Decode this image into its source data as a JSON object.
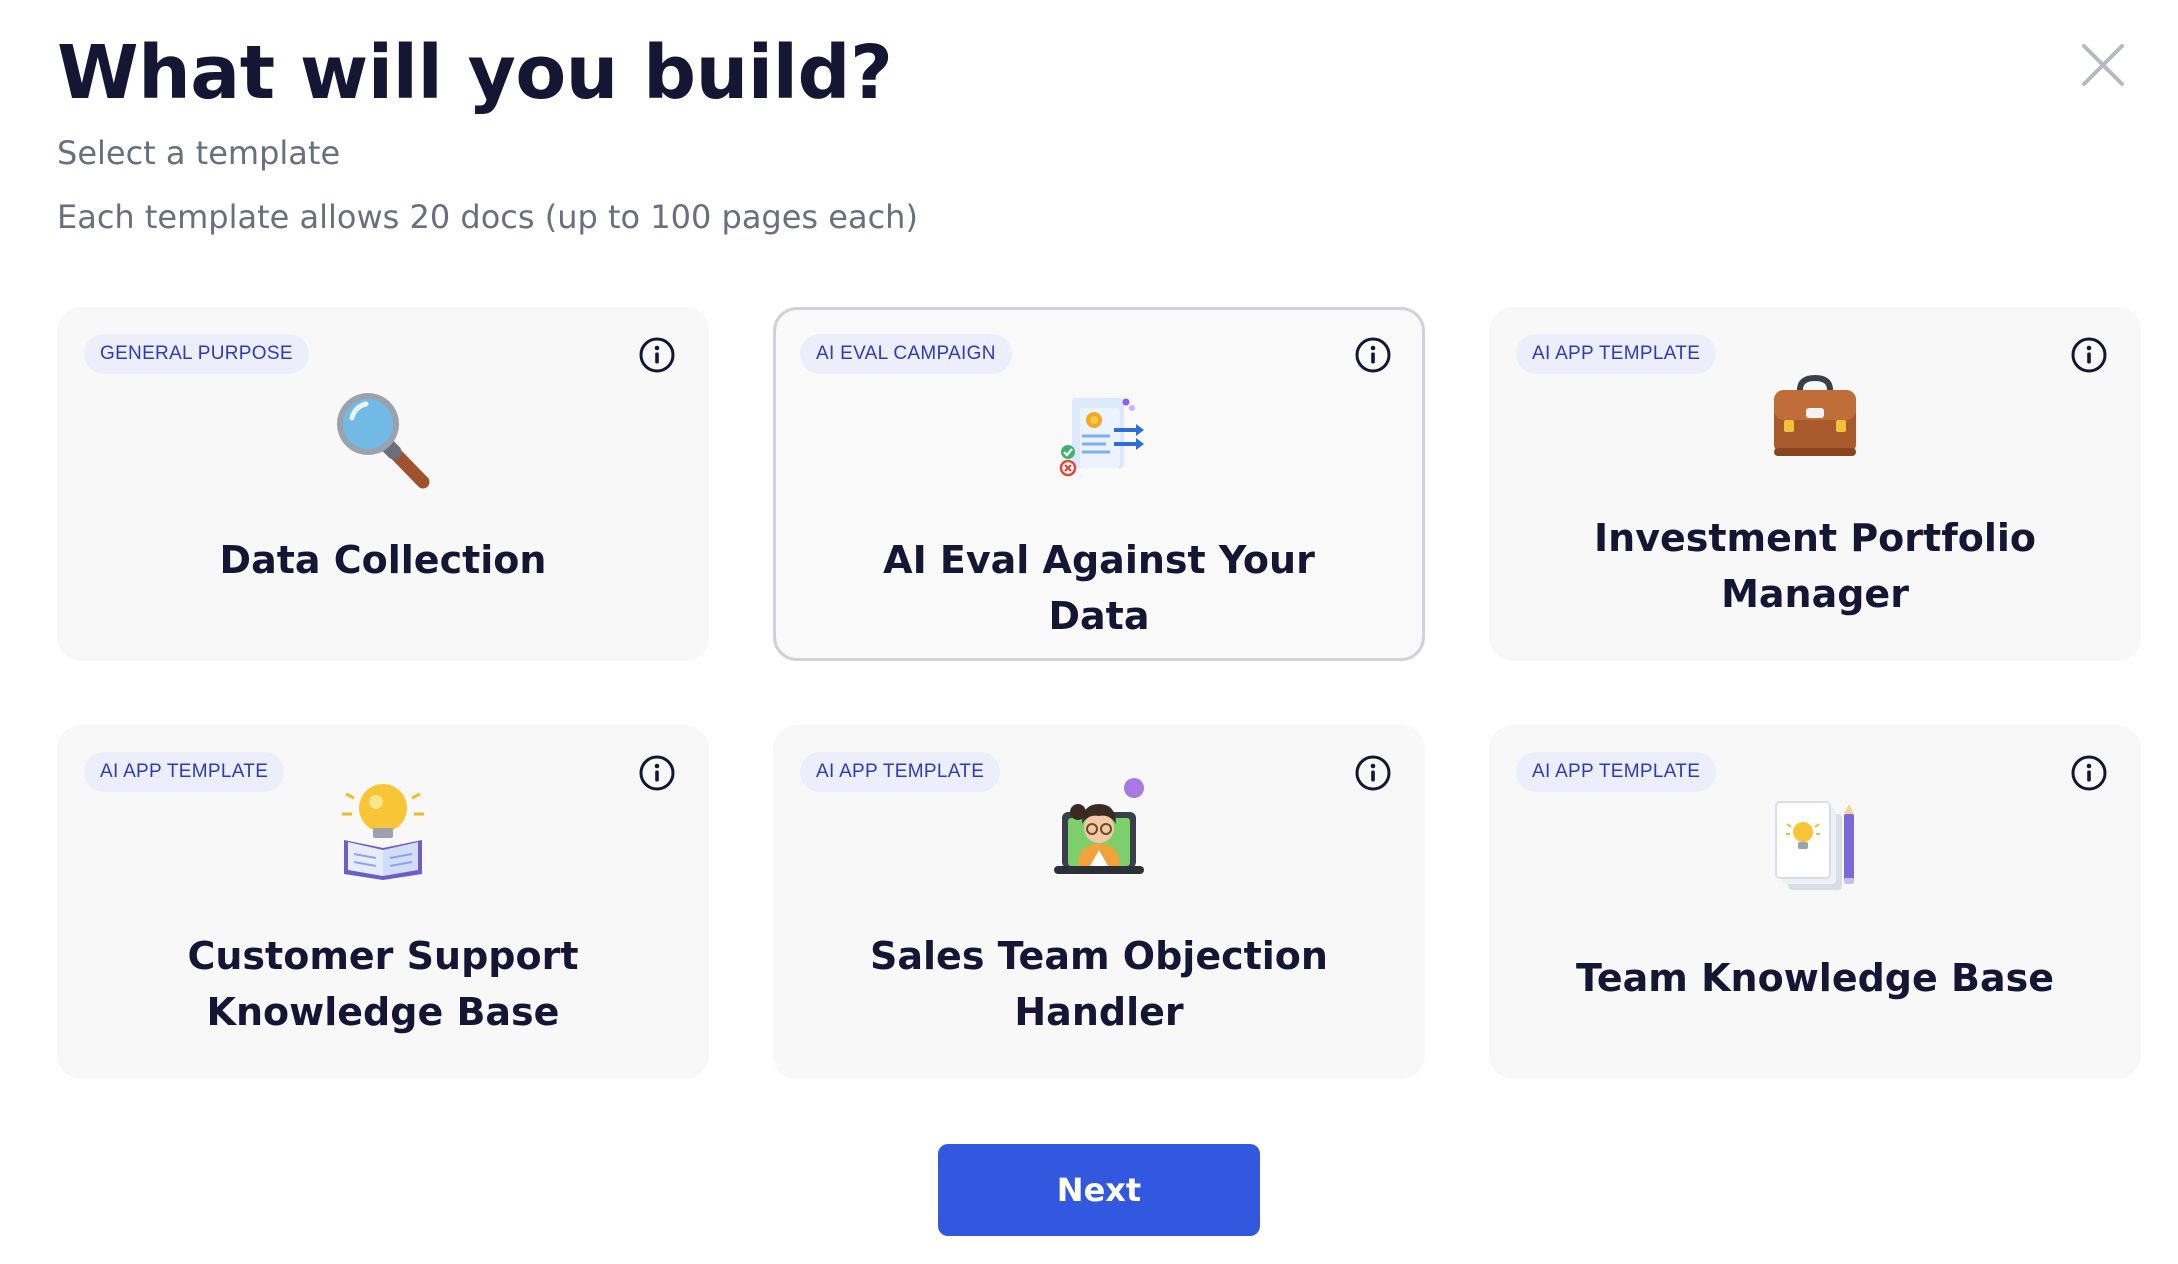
{
  "header": {
    "title": "What will you build?",
    "subtitle": "Select a template",
    "limits": "Each template allows 20 docs (up to 100 pages each)",
    "close_icon": "close-icon"
  },
  "templates": [
    {
      "badge": "GENERAL PURPOSE",
      "name": "Data Collection",
      "icon": "magnifying-glass-icon",
      "selected": false
    },
    {
      "badge": "AI EVAL CAMPAIGN",
      "name": "AI Eval Against Your Data",
      "icon": "document-evaluation-icon",
      "selected": true
    },
    {
      "badge": "AI APP TEMPLATE",
      "name": "Investment Portfolio Manager",
      "icon": "briefcase-icon",
      "selected": false
    },
    {
      "badge": "AI APP TEMPLATE",
      "name": "Customer Support Knowledge Base",
      "icon": "lightbulb-book-icon",
      "selected": false
    },
    {
      "badge": "AI APP TEMPLATE",
      "name": "Sales Team Objection Handler",
      "icon": "person-laptop-icon",
      "selected": false
    },
    {
      "badge": "AI APP TEMPLATE",
      "name": "Team Knowledge Base",
      "icon": "notes-pencil-icon",
      "selected": false
    }
  ],
  "footer": {
    "next_label": "Next"
  },
  "colors": {
    "accent": "#3358e0",
    "badge_text": "#2f3bb5",
    "badge_bg": "#eceffb",
    "card_bg": "#f8f8f9",
    "title": "#141634",
    "muted": "#6b6e7e"
  }
}
